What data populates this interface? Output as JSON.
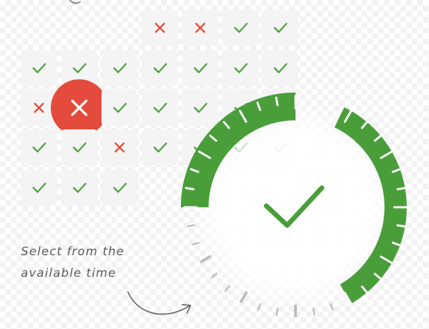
{
  "caption": {
    "line1": "Select from the",
    "line2": "available time"
  },
  "grid": {
    "rows": [
      [
        "",
        "",
        "",
        "",
        "unavailable",
        "unavailable",
        "available",
        "available"
      ],
      [
        "",
        "available",
        "available",
        "available",
        "available",
        "available",
        "available",
        "available"
      ],
      [
        "",
        "unavailable",
        "selected-unavailable",
        "available",
        "available",
        "available",
        "available",
        "available"
      ],
      [
        "",
        "available",
        "available",
        "unavailable",
        "available",
        "available",
        "available",
        "available"
      ],
      [
        "",
        "available",
        "available",
        "available",
        "",
        "",
        "",
        ""
      ]
    ]
  },
  "icons": {
    "available": "check-icon",
    "unavailable": "cross-icon",
    "selected-unavailable": "cross-in-circle-icon",
    "dial_center": "large-check-icon"
  },
  "colors": {
    "check": "#4ea23f",
    "cross": "#e54b3c",
    "badge": "#e44b3c",
    "dial": "#4a9e3a",
    "tick": "#bdbdbd"
  }
}
